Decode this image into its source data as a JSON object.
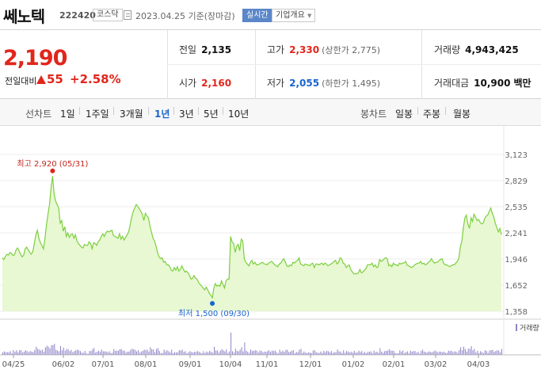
{
  "header": {
    "name": "쎄노텍",
    "code": "222420",
    "market": "코스닥",
    "date_text": "2023.04.25 기준(장마감)",
    "realtime": "실시간",
    "company_info": "기업개요"
  },
  "quote": {
    "price": "2,190",
    "change_label": "전일대비",
    "change": "55",
    "change_rate": "+2.58%",
    "prev_close_label": "전일",
    "prev_close": "2,135",
    "open_label": "시가",
    "open": "2,160",
    "high_label": "고가",
    "high": "2,330",
    "upper_limit": "(상한가 2,775)",
    "low_label": "저가",
    "low": "2,055",
    "lower_limit": "(하한가 1,495)",
    "volume_label": "거래량",
    "volume": "4,943,425",
    "amount_label": "거래대금",
    "amount": "10,900",
    "amount_unit": "백만"
  },
  "line_periods": {
    "label": "선차트",
    "items": [
      "1일",
      "1주일",
      "3개월",
      "1년",
      "3년",
      "5년",
      "10년"
    ],
    "active": "1년"
  },
  "candle_periods": {
    "label": "봉차트",
    "items": [
      "일봉",
      "주봉",
      "월봉"
    ]
  },
  "colors": {
    "up": "#e1261c",
    "down": "#1a63d0",
    "line": "#7ccf3f",
    "area": "#e8f8d2"
  },
  "chart_data": {
    "type": "area",
    "y_ticks": [
      "3,123",
      "2,829",
      "2,535",
      "2,241",
      "1,946",
      "1,652",
      "1,358"
    ],
    "ylim": [
      1358,
      3123
    ],
    "x_ticks": [
      "04/25",
      "06/02",
      "07/01",
      "08/01",
      "09/01",
      "10/04",
      "11/01",
      "12/01",
      "01/02",
      "02/01",
      "03/02",
      "04/03"
    ],
    "max_label": "최고 2,920 (05/31)",
    "min_label": "최저 1,500 (09/30)",
    "max": {
      "index": 33,
      "value": 2920
    },
    "min": {
      "index": 138,
      "value": 1500
    },
    "volume_legend": "거래량",
    "values": [
      1960,
      1940,
      1975,
      2000,
      1990,
      2020,
      2010,
      1985,
      1995,
      2050,
      2070,
      2040,
      2000,
      1970,
      1990,
      2060,
      2080,
      2050,
      2020,
      2000,
      2030,
      2120,
      2220,
      2270,
      2180,
      2130,
      2100,
      2060,
      2180,
      2330,
      2450,
      2560,
      2750,
      2880,
      2680,
      2600,
      2560,
      2520,
      2350,
      2380,
      2260,
      2310,
      2200,
      2240,
      2190,
      2220,
      2230,
      2180,
      2220,
      2150,
      2120,
      2100,
      2080,
      2070,
      2110,
      2100,
      2100,
      2140,
      2120,
      2060,
      2130,
      2120,
      2100,
      2140,
      2160,
      2200,
      2230,
      2200,
      2240,
      2260,
      2250,
      2260,
      2270,
      2210,
      2200,
      2190,
      2180,
      2230,
      2170,
      2200,
      2160,
      2190,
      2220,
      2250,
      2330,
      2420,
      2480,
      2520,
      2560,
      2540,
      2510,
      2480,
      2450,
      2380,
      2460,
      2430,
      2410,
      2320,
      2250,
      2180,
      2150,
      2090,
      2020,
      1970,
      1950,
      1960,
      1910,
      1920,
      1880,
      1880,
      1860,
      1820,
      1810,
      1850,
      1820,
      1860,
      1810,
      1830,
      1870,
      1830,
      1800,
      1810,
      1790,
      1760,
      1720,
      1730,
      1760,
      1730,
      1720,
      1680,
      1660,
      1640,
      1620,
      1600,
      1630,
      1600,
      1560,
      1540,
      1510,
      1620,
      1670,
      1640,
      1650,
      1640,
      1700,
      1660,
      1620,
      1700,
      1720,
      1720,
      2200,
      2140,
      2120,
      2020,
      2090,
      2110,
      2040,
      2170,
      2150,
      1950,
      1910,
      1890,
      1870,
      1910,
      1930,
      1890,
      1910,
      1880,
      1880,
      1890,
      1900,
      1910,
      1890,
      1890,
      1880,
      1900,
      1910,
      1920,
      1900,
      1880,
      1870,
      1860,
      1890,
      1900,
      1930,
      1950,
      1910,
      1870,
      1860,
      1880,
      1870,
      1910,
      1900,
      1920,
      1930,
      1960,
      1890,
      1880,
      1870,
      1890,
      1880,
      1880,
      1870,
      1890,
      1900,
      1850,
      1890,
      1890,
      1880,
      1890,
      1900,
      1880,
      1900,
      1890,
      1870,
      1880,
      1890,
      1900,
      1920,
      1930,
      1890,
      1910,
      1960,
      1950,
      1900,
      1890,
      1850,
      1870,
      1880,
      1830,
      1800,
      1780,
      1780,
      1780,
      1790,
      1830,
      1790,
      1800,
      1820,
      1840,
      1880,
      1880,
      1880,
      1900,
      1860,
      1880,
      1850,
      1860,
      1940,
      1920,
      1930,
      1950,
      1960,
      1950,
      1870,
      1880,
      1860,
      1900,
      1880,
      1880,
      1870,
      1900,
      1890,
      1900,
      1900,
      1920,
      1880,
      1870,
      1860,
      1850,
      1860,
      1880,
      1890,
      1900,
      1900,
      1920,
      1890,
      1900,
      1880,
      1890,
      1910,
      1920,
      1950,
      1920,
      1900,
      1910,
      1910,
      1930,
      1940,
      1950,
      1900,
      1880,
      1880,
      1870,
      1860,
      1870,
      1880,
      1880,
      1900,
      1920,
      1950,
      2080,
      2150,
      2300,
      2410,
      2440,
      2340,
      2290,
      2410,
      2370,
      2450,
      2420,
      2380,
      2390,
      2360,
      2340,
      2350,
      2400,
      2430,
      2440,
      2480,
      2520,
      2460,
      2420,
      2350,
      2300,
      2250,
      2290,
      2220
    ]
  }
}
